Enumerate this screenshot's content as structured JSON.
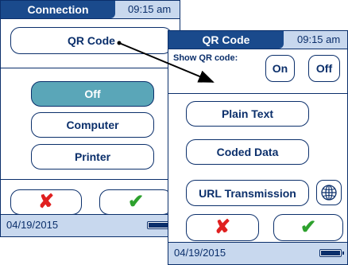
{
  "screen1": {
    "title": "Connection",
    "time": "09:15 am",
    "qr_button_label": "QR Code",
    "options": [
      {
        "label": "Off",
        "selected": true
      },
      {
        "label": "Computer",
        "selected": false
      },
      {
        "label": "Printer",
        "selected": false
      }
    ],
    "cancel_icon": "✘",
    "confirm_icon": "✔",
    "date": "04/19/2015"
  },
  "screen2": {
    "title": "QR Code",
    "time": "09:15 am",
    "show_qr_label": "Show QR code:",
    "on_label": "On",
    "off_label": "Off",
    "options": [
      {
        "label": "Plain Text"
      },
      {
        "label": "Coded Data"
      },
      {
        "label": "URL Transmission"
      }
    ],
    "globe_icon": "globe-icon",
    "cancel_icon": "✘",
    "confirm_icon": "✔",
    "date": "04/19/2015"
  },
  "colors": {
    "navy": "#0b2f6b",
    "title_tab": "#1a4a8c",
    "bar_bg": "#c8d8ee",
    "selected": "#5aa6b8",
    "cancel": "#e02020",
    "confirm": "#2da12d"
  }
}
